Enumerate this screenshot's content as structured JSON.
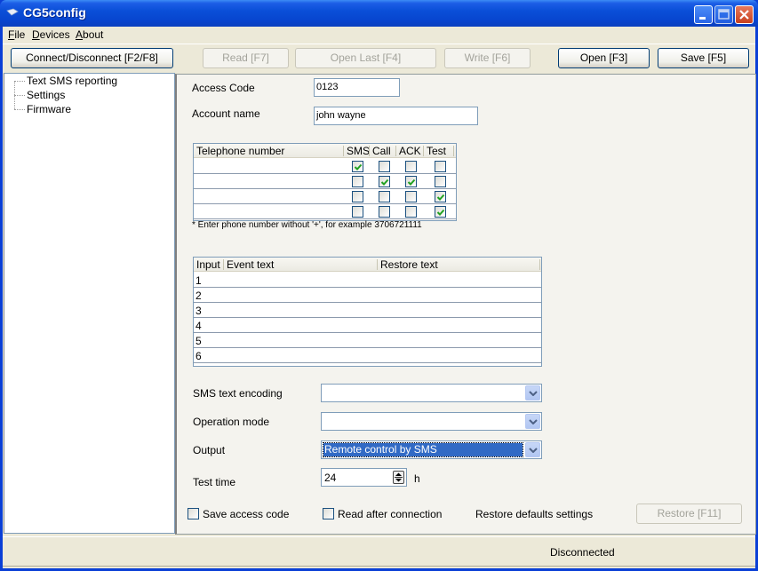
{
  "window": {
    "title": "CG5config",
    "controls": {
      "minimize": "minimize",
      "maximize": "maximize",
      "close": "close"
    }
  },
  "menu": {
    "items": [
      {
        "label": "File",
        "mnemonic": "F",
        "rest": "ile"
      },
      {
        "label": "Devices",
        "mnemonic": "D",
        "rest": "evices"
      },
      {
        "label": "About",
        "mnemonic": "A",
        "rest": "bout"
      }
    ]
  },
  "toolbar": {
    "connect": "Connect/Disconnect [F2/F8]",
    "read": "Read [F7]",
    "open_last": "Open Last [F4]",
    "write": "Write [F6]",
    "open": "Open [F3]",
    "save": "Save [F5]"
  },
  "tree": {
    "items": [
      "Text SMS reporting",
      "Settings",
      "Firmware"
    ]
  },
  "form": {
    "access_code_label": "Access Code",
    "access_code_value": "0123",
    "account_name_label": "Account name",
    "account_name_value": "john wayne"
  },
  "phone_table": {
    "columns": [
      "Telephone number",
      "SMS",
      "Call",
      "ACK",
      "Test"
    ],
    "rows": [
      {
        "number": "",
        "sms": true,
        "call": false,
        "ack": false,
        "test": false
      },
      {
        "number": "",
        "sms": false,
        "call": true,
        "ack": true,
        "test": false
      },
      {
        "number": "",
        "sms": false,
        "call": false,
        "ack": false,
        "test": true
      },
      {
        "number": "",
        "sms": false,
        "call": false,
        "ack": false,
        "test": true
      }
    ],
    "note": "* Enter phone number without '+', for example 3706721111"
  },
  "event_table": {
    "columns": [
      "Input",
      "Event text",
      "Restore text"
    ],
    "rows": [
      {
        "input": "1",
        "event": "",
        "restore": ""
      },
      {
        "input": "2",
        "event": "",
        "restore": ""
      },
      {
        "input": "3",
        "event": "",
        "restore": ""
      },
      {
        "input": "4",
        "event": "",
        "restore": ""
      },
      {
        "input": "5",
        "event": "",
        "restore": ""
      },
      {
        "input": "6",
        "event": "",
        "restore": ""
      }
    ]
  },
  "settings": {
    "sms_encoding_label": "SMS text encoding",
    "sms_encoding_value": "",
    "operation_mode_label": "Operation mode",
    "operation_mode_value": "",
    "output_label": "Output",
    "output_value": "Remote control by SMS",
    "test_time_label": "Test time",
    "test_time_value": "24",
    "test_time_unit": "h"
  },
  "footer": {
    "save_access_code": "Save access code",
    "save_access_code_checked": false,
    "read_after_connection": "Read after connection",
    "read_after_connection_checked": false,
    "restore_defaults_label": "Restore defaults settings",
    "restore_button": "Restore [F11]"
  },
  "status": {
    "text": "Disconnected"
  },
  "colors": {
    "title_bar": "#0a4fd8",
    "selection": "#316ac5",
    "check_mark": "#21a121"
  }
}
